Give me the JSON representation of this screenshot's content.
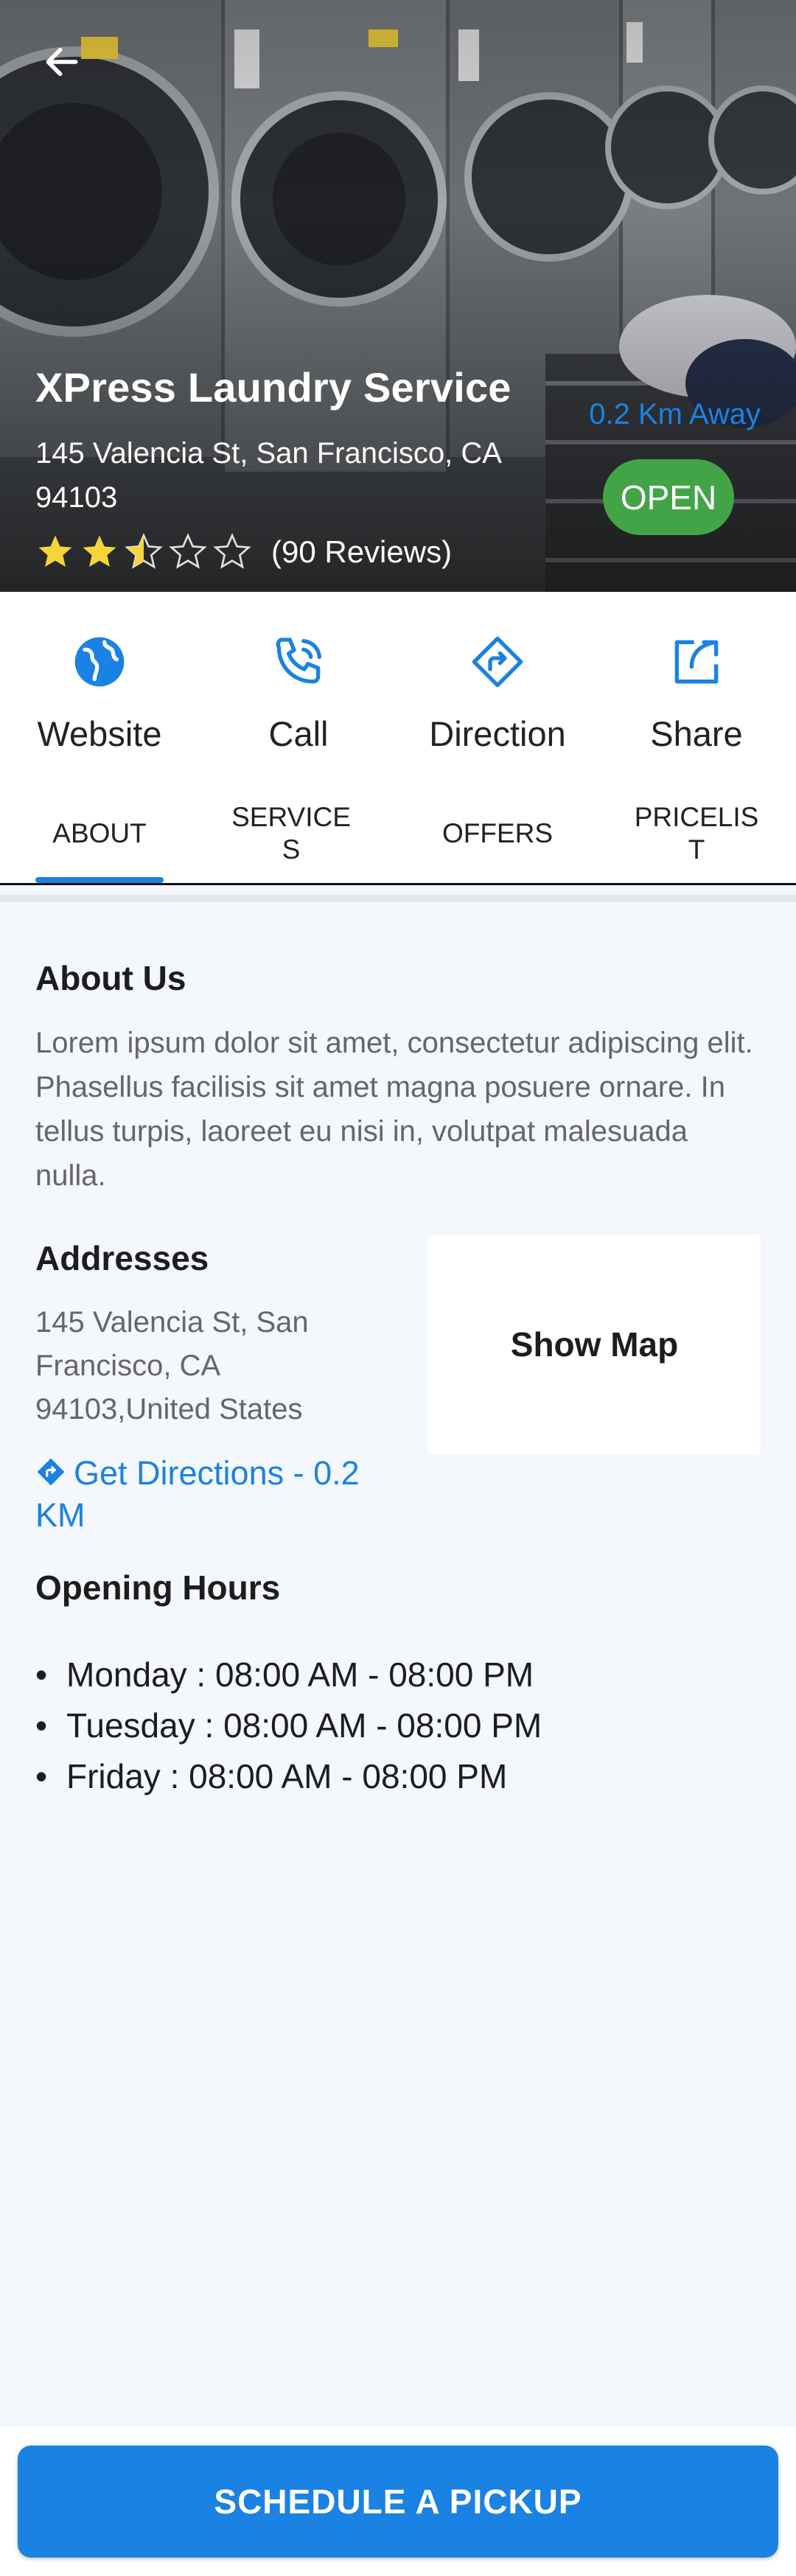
{
  "header": {
    "title": "XPress Laundry Service",
    "address": "145 Valencia St, San Francisco, CA 94103",
    "distance": "0.2 Km Away",
    "status": "OPEN",
    "rating": 2.5,
    "rating_max": 5,
    "reviews": "(90 Reviews)",
    "back_icon": "arrow-left-icon"
  },
  "actions": [
    {
      "label": "Website",
      "icon": "globe-icon"
    },
    {
      "label": "Call",
      "icon": "phone-icon"
    },
    {
      "label": "Direction",
      "icon": "direction-icon"
    },
    {
      "label": "Share",
      "icon": "share-icon"
    }
  ],
  "tabs": [
    {
      "label": "ABOUT",
      "active": true
    },
    {
      "label": "SERVICES",
      "active": false
    },
    {
      "label": "OFFERS",
      "active": false
    },
    {
      "label": "PRICELIST",
      "active": false
    }
  ],
  "about": {
    "heading": "About Us",
    "text": "Lorem ipsum dolor sit amet, consectetur adipiscing elit. Phasellus facilisis sit amet magna posuere ornare. In tellus turpis, laoreet eu nisi in, volutpat malesuada nulla."
  },
  "addresses": {
    "heading": "Addresses",
    "text": "145 Valencia St, San Francisco, CA 94103,United States",
    "directions_label": "Get Directions - 0.2 KM",
    "map_label": "Show Map"
  },
  "hours": {
    "heading": "Opening Hours",
    "items": [
      "Monday : 08:00 AM - 08:00 PM",
      "Tuesday : 08:00 AM - 08:00 PM",
      "Friday : 08:00 AM - 08:00 PM"
    ]
  },
  "cta": {
    "label": "SCHEDULE A PICKUP"
  },
  "colors": {
    "accent": "#1a82e2",
    "open": "#43a447",
    "star": "#f6d53a"
  }
}
